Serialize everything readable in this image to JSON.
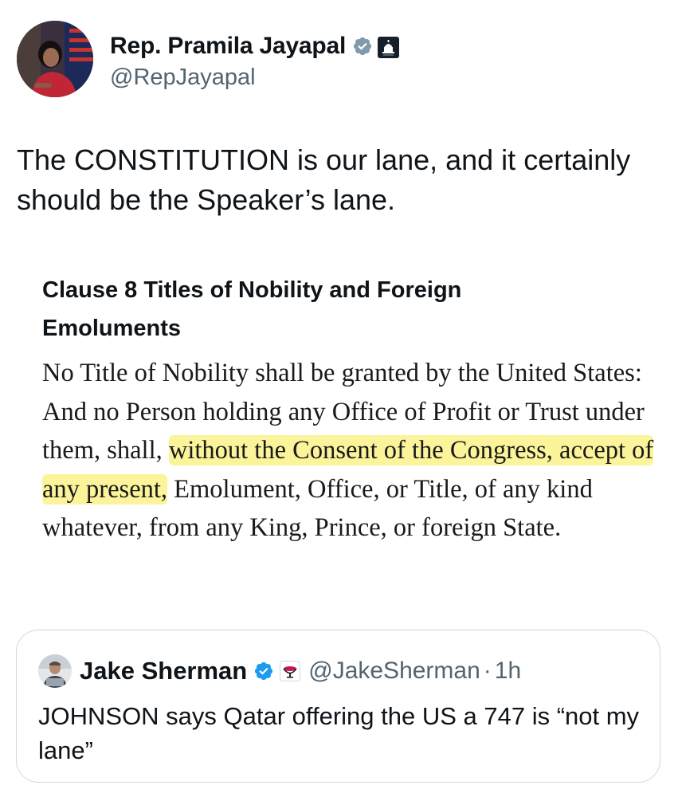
{
  "author": {
    "display_name": "Rep. Pramila Jayapal",
    "handle": "@RepJayapal",
    "avatar_icon": "profile-photo",
    "verified_icon": "verified-badge-gray",
    "affiliation_icon": "us-capitol-badge"
  },
  "tweet": {
    "text": "The CONSTITUTION is our lane, and it certainly should be the Speaker’s lane."
  },
  "document": {
    "heading": "Clause 8 Titles of Nobility and Foreign Emoluments",
    "body_before": "No Title of Nobility shall be granted by the United States: And no Person holding any Office of Profit or Trust under them, shall, ",
    "body_highlight": "without the Consent of the Congress, accept of any present,",
    "body_after": " Emolument, Office, or Title, of any kind whatever, from any King, Prince, or foreign State.",
    "highlight_color": "#fbf49a"
  },
  "quoted_tweet": {
    "display_name": "Jake Sherman",
    "handle": "@JakeSherman",
    "separator": "·",
    "time": "1h",
    "text": "JOHNSON says Qatar offering the US a 747 is “not my lane”",
    "verified_icon": "verified-badge-blue",
    "affiliation_icon": "publication-logo-badge"
  },
  "colors": {
    "text": "#0f1419",
    "secondary": "#536471",
    "verified_blue": "#1d9bf0",
    "verified_gray": "#829aab",
    "border": "#cfd9de"
  }
}
